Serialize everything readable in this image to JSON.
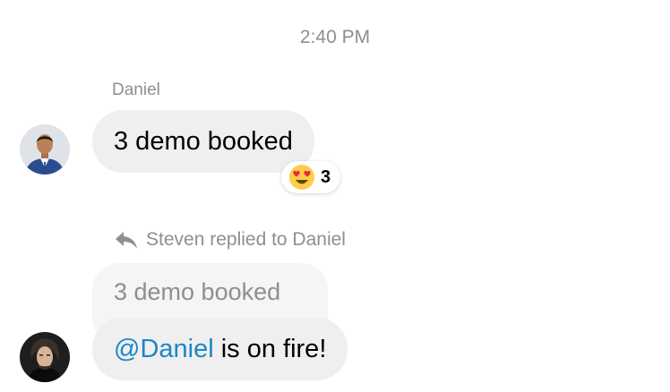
{
  "timestamp": "2:40 PM",
  "messages": [
    {
      "sender": "Daniel",
      "text": "3 demo booked",
      "reaction": {
        "emoji_icon": "heart-eyes-emoji",
        "count": "3"
      }
    },
    {
      "reply_label": "Steven replied to Daniel",
      "quoted_text": "3 demo booked",
      "mention": "@Daniel",
      "text": " is on fire!"
    }
  ],
  "colors": {
    "bubble": "#efefef",
    "quoted_bubble": "#f5f5f5",
    "meta_text": "#8e8e93",
    "mention": "#1b87c8"
  }
}
